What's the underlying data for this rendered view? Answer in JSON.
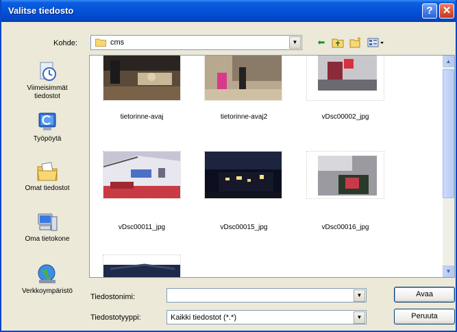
{
  "titlebar": {
    "title": "Valitse tiedosto",
    "help_label": "?",
    "close_label": "✕"
  },
  "lookin": {
    "label": "Kohde:",
    "value": "cms"
  },
  "toolbar": {
    "icons": [
      "back-arrow-icon",
      "up-folder-icon",
      "new-folder-icon",
      "view-menu-icon"
    ]
  },
  "places": [
    {
      "name": "recent",
      "label_line1": "Viimeisimmät",
      "label_line2": "tiedostot",
      "icon": "recent-documents-icon"
    },
    {
      "name": "desktop",
      "label_line1": "Työpöytä",
      "label_line2": "",
      "icon": "desktop-icon"
    },
    {
      "name": "my-documents",
      "label_line1": "Omat tiedostot",
      "label_line2": "",
      "icon": "my-documents-icon"
    },
    {
      "name": "my-computer",
      "label_line1": "Oma tietokone",
      "label_line2": "",
      "icon": "my-computer-icon"
    },
    {
      "name": "network",
      "label_line1": "Verkkoympäristö",
      "label_line2": "",
      "icon": "network-places-icon"
    }
  ],
  "files": [
    {
      "name": "tietorinne-avaj"
    },
    {
      "name": "tietorinne-avaj2"
    },
    {
      "name": "vDsc00002_jpg"
    },
    {
      "name": "vDsc00011_jpg"
    },
    {
      "name": "vDsc00015_jpg"
    },
    {
      "name": "vDsc00016_jpg"
    }
  ],
  "filename": {
    "label": "Tiedostonimi:",
    "value": ""
  },
  "filetype": {
    "label": "Tiedostotyyppi:",
    "value": "Kaikki tiedostot (*.*)"
  },
  "buttons": {
    "open": "Avaa",
    "cancel": "Peruuta"
  }
}
